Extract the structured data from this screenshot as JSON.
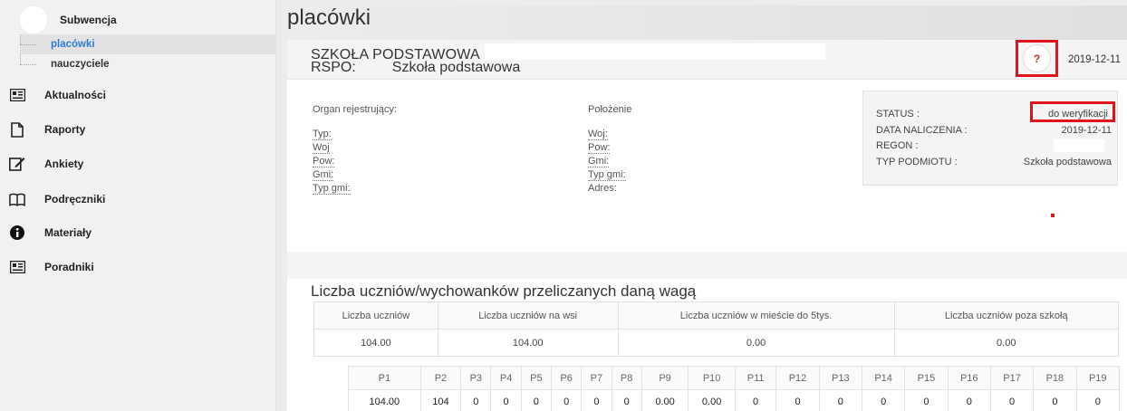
{
  "sidebar": {
    "header": "Subwencja",
    "sub_items": [
      {
        "label": "placówki",
        "active": true
      },
      {
        "label": "nauczyciele",
        "active": false
      }
    ],
    "items": [
      {
        "label": "Aktualności",
        "icon": "newspaper-icon"
      },
      {
        "label": "Raporty",
        "icon": "file-icon"
      },
      {
        "label": "Ankiety",
        "icon": "edit-icon"
      },
      {
        "label": "Podręczniki",
        "icon": "book-icon"
      },
      {
        "label": "Materiały",
        "icon": "info-icon"
      },
      {
        "label": "Poradniki",
        "icon": "newspaper-icon"
      }
    ]
  },
  "page": {
    "title": "placówki"
  },
  "card": {
    "school_name": "SZKOŁA PODSTAWOWA",
    "rspo_label": "RSPO:",
    "rspo_value": "Szkoła podstawowa",
    "help_label": "?",
    "date": "2019-12-11",
    "organ": {
      "title": "Organ rejestrujący:",
      "fields": [
        "Typ:",
        "Woj",
        "Pow:",
        "Gmi:",
        "Typ gmi:"
      ]
    },
    "polozenie": {
      "title": "Położenie",
      "fields": [
        "Woj:",
        "Pow:",
        "Gmi:",
        "Typ gmi:",
        "Adres:"
      ]
    },
    "status": {
      "status_label": "STATUS :",
      "status_value": "do weryfikacji",
      "date_label": "DATA NALICZENIA :",
      "date_value": "2019-12-11",
      "regon_label": "REGON :",
      "type_label": "TYP PODMIOTU :",
      "type_value": "Szkoła podstawowa"
    },
    "section_title": "Liczba uczniów/wychowanków przeliczanych daną wagą",
    "summary": {
      "headers": [
        "Liczba uczniów",
        "Liczba uczniów na wsi",
        "Liczba uczniów w mieście do 5tys.",
        "Liczba uczniów poza szkołą"
      ],
      "values": [
        "104.00",
        "104.00",
        "0.00",
        "0.00"
      ]
    },
    "p_table": {
      "headers": [
        "P1",
        "P2",
        "P3",
        "P4",
        "P5",
        "P6",
        "P7",
        "P8",
        "P9",
        "P10",
        "P11",
        "P12",
        "P13",
        "P14",
        "P15",
        "P16",
        "P17",
        "P18",
        "P19"
      ],
      "values": [
        "104.00",
        "104",
        "0",
        "0",
        "0",
        "0",
        "0",
        "0",
        "0.00",
        "0.00",
        "0",
        "0",
        "0",
        "0",
        "0",
        "0",
        "0",
        "0",
        "0"
      ]
    }
  },
  "colors": {
    "accent": "#2e7bd6",
    "highlight": "#e0151b"
  }
}
